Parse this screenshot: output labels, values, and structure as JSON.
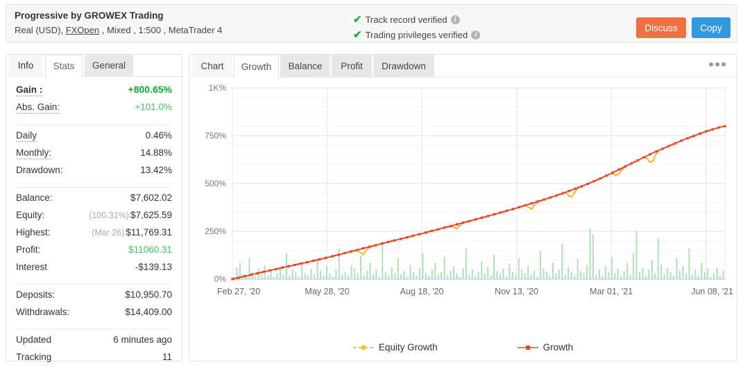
{
  "header": {
    "title": "Progressive by GROWEX Trading",
    "subtitle_prefix": "Real (USD), ",
    "broker": "FXOpen",
    "subtitle_suffix": " , Mixed , 1:500 , MetaTrader 4",
    "verifications": [
      {
        "label": "Track record verified",
        "info": "i"
      },
      {
        "label": "Trading privileges verified",
        "info": "i"
      }
    ],
    "discuss_label": "Discuss",
    "copy_label": "Copy",
    "discuss_color": "#ef7043",
    "copy_color": "#3498db",
    "check_color": "#22ac38"
  },
  "sidebar": {
    "tabs": [
      {
        "label": "Info",
        "active": false
      },
      {
        "label": "Stats",
        "active": true
      },
      {
        "label": "General",
        "active": false
      }
    ],
    "groups": [
      {
        "rows": [
          {
            "label": "Gain :",
            "value": "+800.65%",
            "style": "green-bold",
            "dotted": true,
            "bold": true
          },
          {
            "label": "Abs. Gain:",
            "value": "+101.0%",
            "style": "green-plain",
            "dotted": true
          }
        ]
      },
      {
        "rows": [
          {
            "label": "Daily",
            "value": "0.46%",
            "dotted": true
          },
          {
            "label": "Monthly:",
            "value": "14.88%",
            "dotted": true
          },
          {
            "label": "Drawdown:",
            "value": "13.42%"
          }
        ]
      },
      {
        "rows": [
          {
            "label": "Balance:",
            "value": "$7,602.02"
          },
          {
            "label": "Equity:",
            "sub": "(100.31%)",
            "value": "$7,625.59"
          },
          {
            "label": "Highest:",
            "sub": "(Mar 26)",
            "value": "$11,769.31"
          },
          {
            "label": "Profit:",
            "value": "$11060.31",
            "style": "green-plain"
          },
          {
            "label": "Interest",
            "value": "-$139.13"
          }
        ]
      },
      {
        "rows": [
          {
            "label": "Deposits:",
            "value": "$10,950.70"
          },
          {
            "label": "Withdrawals:",
            "value": "$14,409.00"
          }
        ]
      },
      {
        "rows": [
          {
            "label": "Updated",
            "value": "6 minutes ago"
          },
          {
            "label": "Tracking",
            "value": "11"
          }
        ]
      }
    ]
  },
  "main": {
    "tabs": [
      {
        "label": "Chart",
        "state": "plain"
      },
      {
        "label": "Growth",
        "state": "active"
      },
      {
        "label": "Balance",
        "state": "grey"
      },
      {
        "label": "Profit",
        "state": "grey"
      },
      {
        "label": "Drawdown",
        "state": "grey"
      }
    ],
    "menu_icon": "ellipsis-icon"
  },
  "chart_data": {
    "type": "line",
    "title": "",
    "xlabel": "",
    "ylabel": "",
    "ylim": [
      0,
      1000
    ],
    "yticks": [
      0,
      250,
      500,
      750,
      1000
    ],
    "ytick_labels": [
      "0%",
      "250%",
      "500%",
      "750%",
      "1K%"
    ],
    "grid": true,
    "legend_position": "bottom",
    "xtick_labels": [
      "Feb 27, '20",
      "May 28, '20",
      "Aug 18, '20",
      "Nov 13, '20",
      "Mar 01, '21",
      "Jun 08, '21"
    ],
    "xtick_positions": [
      0,
      0.1923,
      0.3846,
      0.5769,
      0.7692,
      0.9615
    ],
    "series": [
      {
        "name": "Growth",
        "color": "#e8452c",
        "marker_color": "#e8452c",
        "values": [
          0,
          4,
          7,
          11,
          15,
          18,
          23,
          27,
          30,
          34,
          38,
          41,
          45,
          49,
          52,
          56,
          60,
          63,
          67,
          70,
          74,
          78,
          81,
          85,
          88,
          92,
          96,
          99,
          103,
          107,
          111,
          115,
          119,
          123,
          127,
          131,
          136,
          140,
          144,
          148,
          152,
          157,
          161,
          165,
          169,
          173,
          177,
          182,
          186,
          190,
          194,
          198,
          202,
          206,
          210,
          214,
          218,
          222,
          227,
          231,
          235,
          239,
          243,
          248,
          252,
          256,
          260,
          265,
          269,
          273,
          277,
          282,
          286,
          290,
          295,
          299,
          303,
          308,
          312,
          316,
          321,
          325,
          330,
          334,
          339,
          343,
          348,
          352,
          357,
          362,
          366,
          371,
          376,
          381,
          386,
          391,
          396,
          401,
          406,
          411,
          416,
          421,
          427,
          432,
          438,
          443,
          449,
          455,
          461,
          467,
          473,
          479,
          485,
          492,
          498,
          505,
          512,
          519,
          526,
          534,
          541,
          549,
          557,
          565,
          573,
          581,
          589,
          597,
          605,
          613,
          621,
          629,
          637,
          645,
          653,
          661,
          668,
          675,
          682,
          689,
          696,
          703,
          710,
          717,
          724,
          731,
          737,
          743,
          749,
          755,
          761,
          767,
          773,
          778,
          783,
          788,
          793,
          797,
          800
        ]
      },
      {
        "name": "Equity Growth",
        "color": "#f5a623",
        "marker_color": "#f5c21e",
        "description": "Tracks Growth closely with periodic downward drawdown spikes",
        "dips": [
          {
            "x": 0.265,
            "depth": 34
          },
          {
            "x": 0.455,
            "depth": 22
          },
          {
            "x": 0.607,
            "depth": 30
          },
          {
            "x": 0.688,
            "depth": 42
          },
          {
            "x": 0.782,
            "depth": 30
          },
          {
            "x": 0.851,
            "depth": 56
          }
        ]
      },
      {
        "name": "Volume Bars",
        "color": "#a5d8ab",
        "type": "bar",
        "baseline_color": "#bcd7ea",
        "description": "Light green trade-volume bars along the x-axis baseline",
        "values": [
          2,
          10,
          14,
          4,
          3,
          18,
          6,
          2,
          9,
          4,
          12,
          3,
          7,
          2,
          5,
          10,
          4,
          22,
          3,
          8,
          6,
          2,
          14,
          5,
          3,
          9,
          4,
          18,
          7,
          3,
          11,
          5,
          2,
          8,
          26,
          4,
          6,
          3,
          12,
          9,
          5,
          20,
          3,
          7,
          14,
          4,
          8,
          2,
          31,
          6,
          3,
          10,
          5,
          18,
          4,
          7,
          2,
          12,
          6,
          3,
          9,
          22,
          5,
          3,
          8,
          14,
          4,
          6,
          19,
          3,
          7,
          11,
          5,
          2,
          9,
          26,
          4,
          8,
          3,
          6,
          15,
          5,
          10,
          3,
          21,
          7,
          4,
          9,
          2,
          13,
          6,
          3,
          18,
          8,
          5,
          11,
          4,
          7,
          2,
          24,
          9,
          6,
          3,
          14,
          5,
          8,
          30,
          4,
          10,
          6,
          3,
          17,
          7,
          5,
          12,
          43,
          38,
          4,
          8,
          3,
          11,
          6,
          19,
          5,
          9,
          3,
          7,
          14,
          4,
          22,
          41,
          6,
          10,
          3,
          8,
          16,
          5,
          35,
          12,
          4,
          9,
          6,
          3,
          18,
          7,
          11,
          5,
          26,
          4,
          8,
          3,
          14,
          6,
          9,
          2,
          5,
          10,
          3,
          7
        ]
      }
    ]
  }
}
